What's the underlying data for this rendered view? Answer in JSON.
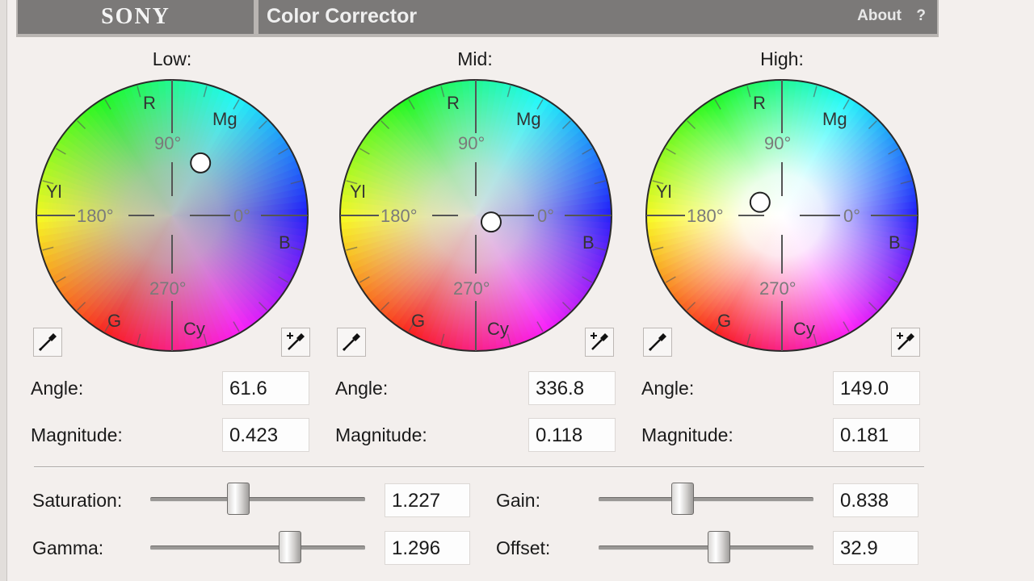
{
  "header": {
    "brand": "SONY",
    "title": "Color Corrector",
    "about": "About",
    "help": "?"
  },
  "wheel_labels": {
    "r": "R",
    "mg": "Mg",
    "yl": "Yl",
    "b": "B",
    "g": "G",
    "cy": "Cy",
    "d90": "90°",
    "d180": "180°",
    "d0": "0°",
    "d270": "270°"
  },
  "wheels": [
    {
      "title": "Low:",
      "angle_label": "Angle:",
      "angle": "61.6",
      "magnitude_label": "Magnitude:",
      "magnitude": "0.423"
    },
    {
      "title": "Mid:",
      "angle_label": "Angle:",
      "angle": "336.8",
      "magnitude_label": "Magnitude:",
      "magnitude": "0.118"
    },
    {
      "title": "High:",
      "angle_label": "Angle:",
      "angle": "149.0",
      "magnitude_label": "Magnitude:",
      "magnitude": "0.181"
    }
  ],
  "sliders": {
    "saturation": {
      "label": "Saturation:",
      "value": "1.227",
      "position": 0.41
    },
    "gamma": {
      "label": "Gamma:",
      "value": "1.296",
      "position": 0.65
    },
    "gain": {
      "label": "Gain:",
      "value": "0.838",
      "position": 0.39
    },
    "offset": {
      "label": "Offset:",
      "value": "32.9",
      "position": 0.56
    }
  }
}
